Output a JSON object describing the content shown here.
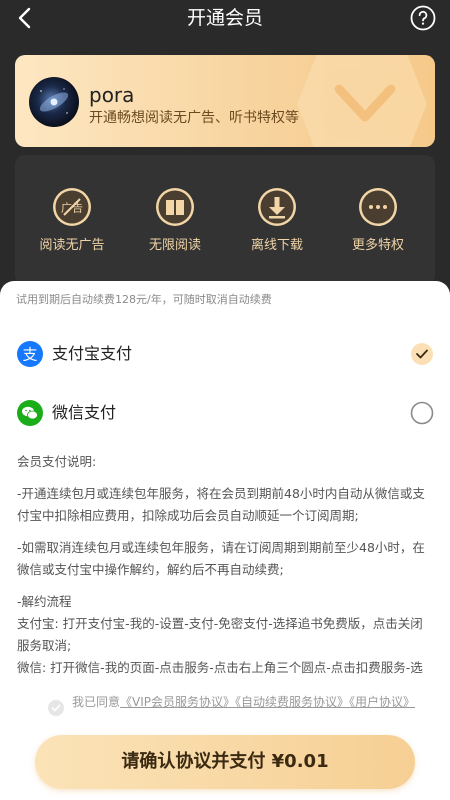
{
  "header": {
    "title": "开通会员"
  },
  "member": {
    "username": "pora",
    "subtitle": "开通畅想阅读无广告、听书特权等"
  },
  "privileges": [
    {
      "label": "阅读无广告",
      "icon": "no-ad-icon"
    },
    {
      "label": "无限阅读",
      "icon": "book-icon"
    },
    {
      "label": "离线下载",
      "icon": "download-icon"
    },
    {
      "label": "更多特权",
      "icon": "more-icon"
    }
  ],
  "sheet": {
    "renew_note": "试用到期后自动续费128元/年，可随时取消自动续费",
    "payment_methods": [
      {
        "label": "支付宝支付",
        "icon": "alipay-icon",
        "selected": true
      },
      {
        "label": "微信支付",
        "icon": "wechat-pay-icon",
        "selected": false
      }
    ],
    "terms": {
      "title": "会员支付说明:",
      "p1": "-开通连续包月或连续包年服务，将在会员到期前48小时内自动从微信或支付宝中扣除相应费用，扣除成功后会员自动顺延一个订阅周期;",
      "p2": "-如需取消连续包月或连续包年服务，请在订阅周期到期前至少48小时，在微信或支付宝中操作解约，解约后不再自动续费;",
      "p3": "-解约流程",
      "p4": "支付宝: 打开支付宝-我的-设置-支付-免密支付-选择追书免费版，点击关闭服务取消;",
      "p5": "微信: 打开微信-我的页面-点击服务-点击右上角三个圆点-点击扣费服务-选择追书免费版，点击关闭服务取消"
    },
    "agreement": {
      "prefix": "我已同意",
      "link1": "《VIP会员服务协议》",
      "link2": "《自动续费服务协议》",
      "link3": "《用户协议》"
    },
    "confirm_label": "请确认协议并支付 ¥0.01"
  },
  "colors": {
    "accent_gold": "#f6cf93",
    "privilege_text": "#f0d4a6",
    "alipay_blue": "#1677ff",
    "wechat_green": "#1aad19"
  }
}
